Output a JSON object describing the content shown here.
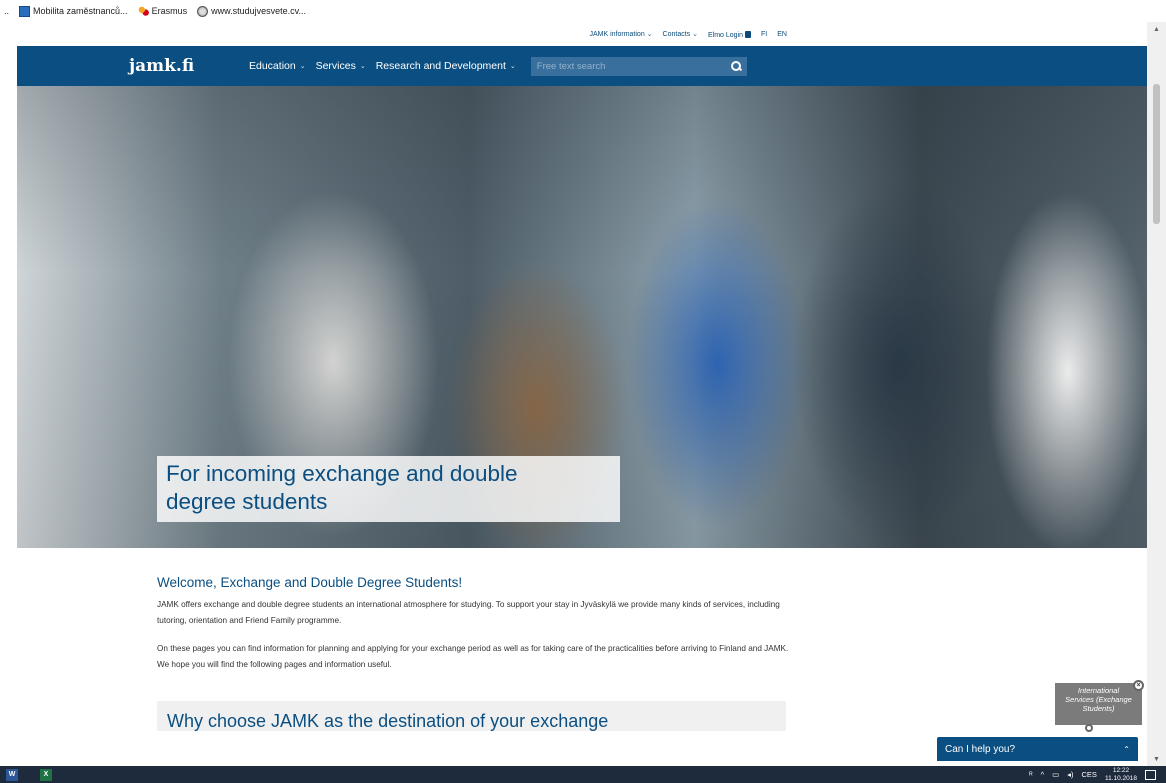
{
  "bookmarks": [
    {
      "label": "Mobilita zaměstnanců...",
      "icon": "document-icon"
    },
    {
      "label": "Erasmus",
      "icon": "people-icon"
    },
    {
      "label": "www.studujvesvete.cv...",
      "icon": "globe-icon"
    }
  ],
  "bookmarks_lead": "..",
  "utility_nav": {
    "jamk_information": "JAMK information",
    "contacts": "Contacts",
    "elmo_login": "Elmo Login",
    "lang_fi": "FI",
    "lang_en": "EN"
  },
  "header": {
    "logo": "jamk.fi",
    "nav": [
      {
        "label": "Education"
      },
      {
        "label": "Services"
      },
      {
        "label": "Research and Development"
      }
    ],
    "search_placeholder": "Free text search"
  },
  "hero": {
    "caption_line1": "For incoming exchange and double",
    "caption_line2": "degree students"
  },
  "main": {
    "heading": "Welcome, Exchange and Double Degree Students!",
    "paragraph1": "JAMK offers exchange and double degree students an international atmosphere for studying. To support your stay in Jyväskylä we provide many kinds of services, including tutoring, orientation and Friend Family programme.",
    "paragraph2": "On these pages you can find information for planning and applying for your exchange period as well as for taking care of the practicalities before arriving to Finland and JAMK. We hope you will find the following pages and information useful.",
    "section_heading": "Why choose JAMK as the destination of your exchange"
  },
  "chat": {
    "bubble_text": "International Services (Exchange Students)",
    "bar_label": "Can I help you?"
  },
  "taskbar": {
    "word_label": "W",
    "excel_label": "X",
    "language": "CES",
    "time": "12:22",
    "date": "11.10.2018"
  },
  "colors": {
    "brand_blue": "#0b4f82",
    "taskbar": "#1d2b3d"
  }
}
